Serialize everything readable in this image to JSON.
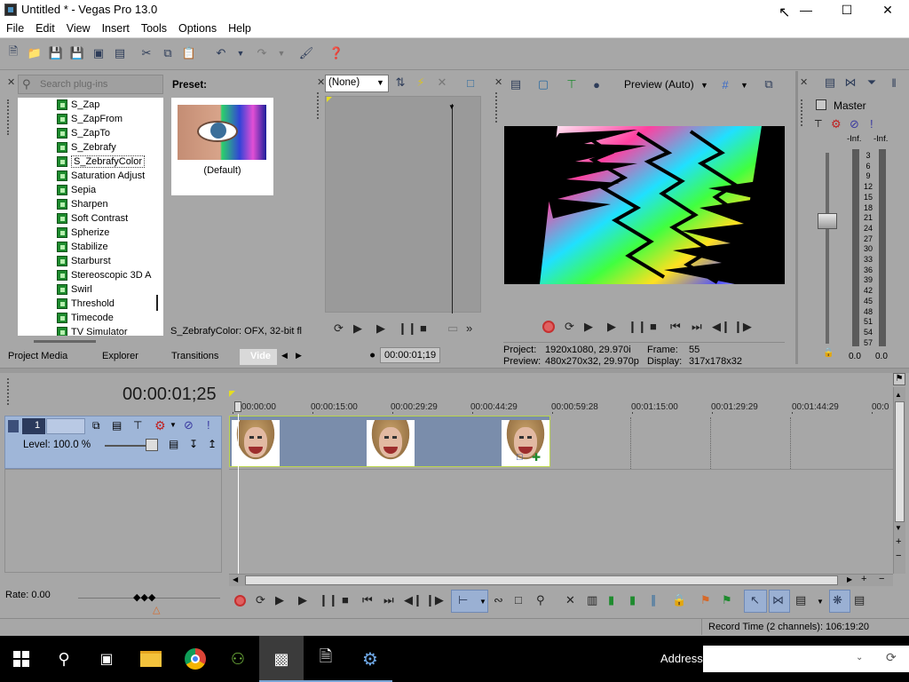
{
  "window": {
    "title": "Untitled * - Vegas Pro 13.0"
  },
  "menu": [
    "File",
    "Edit",
    "View",
    "Insert",
    "Tools",
    "Options",
    "Help"
  ],
  "plugin_chooser": {
    "search_placeholder": "Search plug-ins",
    "items": [
      "S_Zap",
      "S_ZapFrom",
      "S_ZapTo",
      "S_Zebrafy",
      "S_ZebrafyColor",
      "Saturation Adjust",
      "Sepia",
      "Sharpen",
      "Soft Contrast",
      "Spherize",
      "Stabilize",
      "Starburst",
      "Stereoscopic 3D A",
      "Swirl",
      "Threshold",
      "Timecode",
      "TV Simulator"
    ],
    "selected": "S_ZebrafyColor",
    "preset_label": "Preset:",
    "preset_name": "(Default)",
    "description": "S_ZebrafyColor: OFX, 32-bit fl"
  },
  "tabs": [
    "Project Media",
    "Explorer",
    "Transitions",
    "Vide"
  ],
  "trimmer": {
    "dropdown": "(None)",
    "timecode": "00:00:01;19"
  },
  "preview": {
    "quality": "Preview (Auto)",
    "project_label": "Project:",
    "project_value": "1920x1080, 29.970i",
    "preview_label": "Preview:",
    "preview_value": "480x270x32, 29.970p",
    "frame_label": "Frame:",
    "frame_value": "55",
    "display_label": "Display:",
    "display_value": "317x178x32"
  },
  "master": {
    "title": "Master",
    "left_inf": "-Inf.",
    "right_inf": "-Inf.",
    "scale": [
      "3",
      "6",
      "9",
      "12",
      "15",
      "18",
      "21",
      "24",
      "27",
      "30",
      "33",
      "36",
      "39",
      "42",
      "45",
      "48",
      "51",
      "54",
      "57"
    ],
    "left_val": "0.0",
    "right_val": "0.0"
  },
  "timeline": {
    "timecode": "00:00:01;25",
    "track_number": "1",
    "level": "Level: 100.0 %",
    "ruler": [
      "00:00:00",
      "00:00:15:00",
      "00:00:29:29",
      "00:00:44:29",
      "00:00:59:28",
      "00:01:15:00",
      "00:01:29:29",
      "00:01:44:29",
      "00:0"
    ],
    "rate": "Rate: 0.00"
  },
  "status": {
    "record_time": "Record Time (2 channels): 106:19:20"
  },
  "taskbar": {
    "address_label": "Address"
  }
}
